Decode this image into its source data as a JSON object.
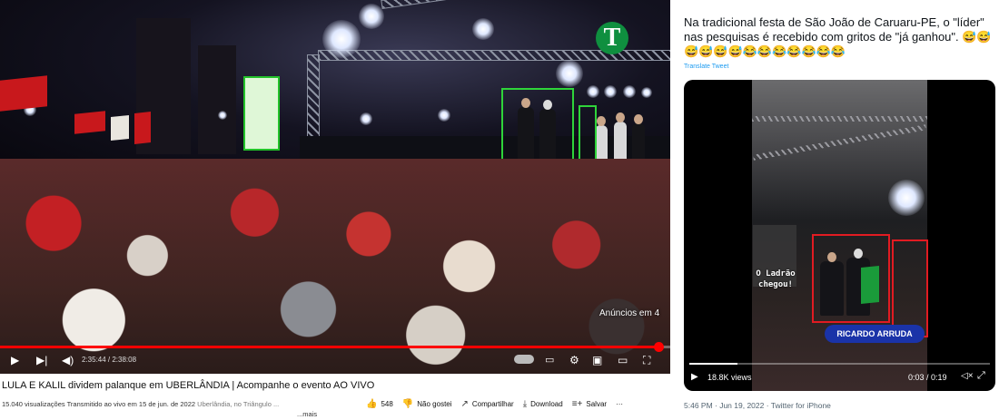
{
  "youtube": {
    "watermark_letter": "T",
    "ads_text": "Anúncios em 4",
    "time_display": "2:35:44 / 2:38:08",
    "progress_fraction": 0.983,
    "title": "LULA E KALIL dividem palanque em UBERLÂNDIA | Acompanhe o evento AO VIVO",
    "meta": {
      "views": "15.040 visualizações",
      "streamed": "Transmitido ao vivo em 15 de jun. de 2022",
      "location": "Uberlândia, no Triângulo ...",
      "more": "...mais"
    },
    "actions": {
      "likes": "548",
      "dislike": "Não gostei",
      "share": "Compartilhar",
      "download": "Download",
      "save": "Salvar",
      "more": "···"
    },
    "icons": [
      "play-icon",
      "next-icon",
      "volume-icon",
      "autoplay-toggle",
      "subtitles-icon",
      "settings-gear-icon",
      "miniplayer-icon",
      "theater-icon",
      "fullscreen-icon"
    ]
  },
  "tweet": {
    "text": "Na tradicional festa de São João de Caruaru-PE, o \"líder\" nas pesquisas é recebido com gritos de \"já ganhou\". 😅😅😅😅😅😅😂😂😂😂😂😂😂",
    "translate": "Translate Tweet",
    "video": {
      "overlay_text": "O Ladrão chegou!",
      "banner": "RICARDO ARRUDA",
      "views": "18.8K views",
      "time": "0:03 / 0:19",
      "progress_fraction": 0.16
    },
    "footer": "5:46 PM · Jun 19, 2022 · Twitter for iPhone"
  },
  "colors": {
    "youtube_red": "#ff0000",
    "green_box": "#2fd43a",
    "red_box": "#e11b22",
    "twitter_blue": "#1d9bf0",
    "banner_blue": "#1a33a8"
  }
}
